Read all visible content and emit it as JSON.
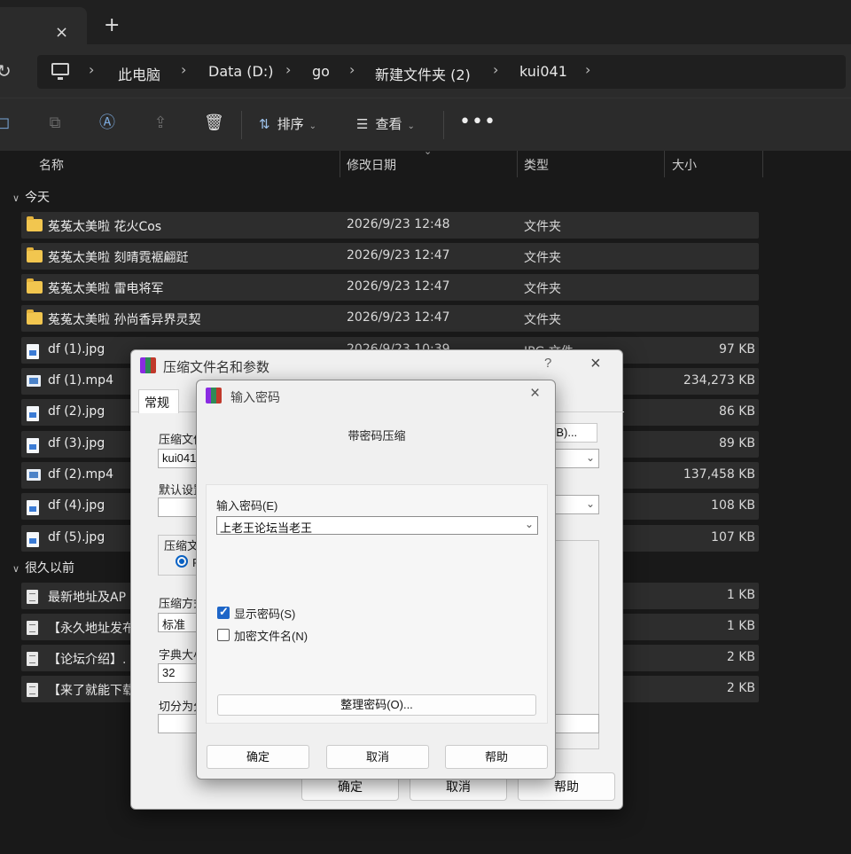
{
  "tabbar": {
    "close_icon": "×",
    "add_icon": "+"
  },
  "address": {
    "refresh_icon": "↻",
    "crumbs": [
      "此电脑",
      "Data (D:)",
      "go",
      "新建文件夹 (2)",
      "kui041"
    ],
    "separator": "›"
  },
  "toolbar": {
    "sort_label": "排序",
    "view_label": "查看",
    "more_label": "•••"
  },
  "columns": {
    "name": "名称",
    "modified": "修改日期",
    "type": "类型",
    "size": "大小"
  },
  "groups": {
    "today": "今天",
    "long_ago": "很久以前"
  },
  "rows": [
    {
      "name": "菟菟太美啦 花火Cos",
      "date": "2026/9/23 12:48",
      "type": "文件夹",
      "size": "",
      "icon": "folder"
    },
    {
      "name": "菟菟太美啦 刻晴霓裾翩跹",
      "date": "2026/9/23 12:47",
      "type": "文件夹",
      "size": "",
      "icon": "folder"
    },
    {
      "name": "菟菟太美啦 雷电将军",
      "date": "2026/9/23 12:47",
      "type": "文件夹",
      "size": "",
      "icon": "folder"
    },
    {
      "name": "菟菟太美啦 孙尚香异界灵契",
      "date": "2026/9/23 12:47",
      "type": "文件夹",
      "size": "",
      "icon": "folder"
    },
    {
      "name": "df (1).jpg",
      "date": "2026/9/23 10:39",
      "type": "JPG 文件",
      "size": "97 KB",
      "icon": "image"
    },
    {
      "name": "df (1).mp4",
      "date": "",
      "type": "",
      "size": "234,273 KB",
      "icon": "video"
    },
    {
      "name": "df (2).jpg",
      "date": "",
      "type": "",
      "size": "86 KB",
      "icon": "image"
    },
    {
      "name": "df (3).jpg",
      "date": "",
      "type": "",
      "size": "89 KB",
      "icon": "image"
    },
    {
      "name": "df (2).mp4",
      "date": "",
      "type": "",
      "size": "137,458 KB",
      "icon": "video"
    },
    {
      "name": "df (4).jpg",
      "date": "",
      "type": "",
      "size": "108 KB",
      "icon": "image"
    },
    {
      "name": "df (5).jpg",
      "date": "",
      "type": "",
      "size": "107 KB",
      "icon": "image"
    }
  ],
  "old_rows": [
    {
      "name": "最新地址及AP",
      "size": "1 KB",
      "icon": "doc"
    },
    {
      "name": "【永久地址发布",
      "size": "1 KB",
      "icon": "doc"
    },
    {
      "name": "【论坛介绍】.",
      "size": "2 KB",
      "icon": "doc"
    },
    {
      "name": "【来了就能下载",
      "size": "2 KB",
      "icon": "doc"
    }
  ],
  "archive_dialog": {
    "title": "压缩文件名和参数",
    "help_icon": "?",
    "close_icon": "×",
    "tab_general": "常规",
    "label_archive_name": "压缩文件",
    "archive_name_value": "kui041",
    "browse_label": "(B)...",
    "label_default": "默认设置",
    "label_format": "压缩文",
    "radio_label": "R",
    "label_method": "压缩方式",
    "method_value": "标准",
    "label_dict": "字典大小",
    "dict_value": "32",
    "label_split": "切分为分卷",
    "ok": "确定",
    "cancel": "取消",
    "help": "帮助"
  },
  "password_dialog": {
    "title": "输入密码",
    "close_icon": "×",
    "heading": "带密码压缩",
    "label_enter": "输入密码(E)",
    "password_value": "上老王论坛当老王",
    "show_password": "显示密码(S)",
    "show_password_checked": true,
    "encrypt_names": "加密文件名(N)",
    "encrypt_names_checked": false,
    "manage": "整理密码(O)...",
    "ok": "确定",
    "cancel": "取消",
    "help": "帮助"
  }
}
